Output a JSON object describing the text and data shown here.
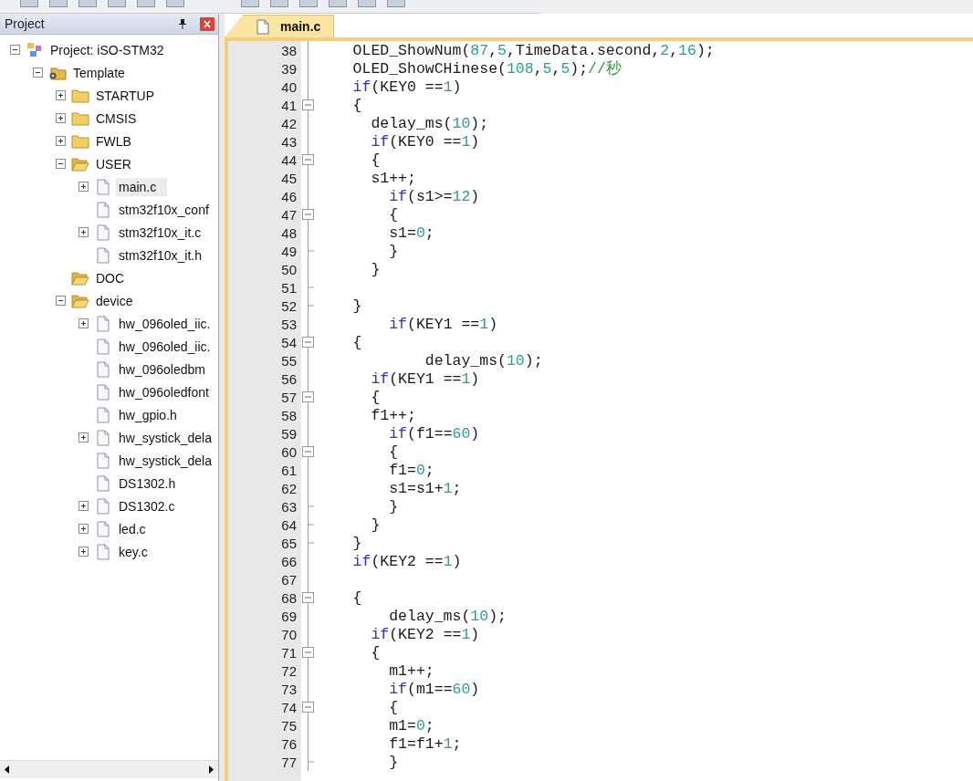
{
  "project_panel": {
    "title": "Project",
    "items": [
      {
        "label": "Project: iSO-STM32",
        "kind": "project",
        "expanded": true,
        "selected": false,
        "children": [
          {
            "label": "Template",
            "kind": "target",
            "expanded": true,
            "selected": false,
            "children": [
              {
                "label": "STARTUP",
                "kind": "folder",
                "expanded": false,
                "selected": false
              },
              {
                "label": "CMSIS",
                "kind": "folder",
                "expanded": false,
                "selected": false
              },
              {
                "label": "FWLB",
                "kind": "folder",
                "expanded": false,
                "selected": false
              },
              {
                "label": "USER",
                "kind": "open-folder",
                "expanded": true,
                "selected": false,
                "children": [
                  {
                    "label": "main.c",
                    "kind": "file",
                    "expanded": false,
                    "selected": true
                  },
                  {
                    "label": "stm32f10x_conf",
                    "kind": "file",
                    "selected": false
                  },
                  {
                    "label": "stm32f10x_it.c",
                    "kind": "file",
                    "expanded": false,
                    "selected": false
                  },
                  {
                    "label": "stm32f10x_it.h",
                    "kind": "file",
                    "selected": false
                  }
                ]
              },
              {
                "label": "DOC",
                "kind": "open-folder",
                "selected": false
              },
              {
                "label": "device",
                "kind": "open-folder",
                "expanded": true,
                "selected": false,
                "children": [
                  {
                    "label": "hw_096oled_iic.",
                    "kind": "file",
                    "expanded": false,
                    "selected": false
                  },
                  {
                    "label": "hw_096oled_iic.",
                    "kind": "file",
                    "selected": false
                  },
                  {
                    "label": "hw_096oledbm",
                    "kind": "file",
                    "selected": false
                  },
                  {
                    "label": "hw_096oledfont",
                    "kind": "file",
                    "selected": false
                  },
                  {
                    "label": "hw_gpio.h",
                    "kind": "file",
                    "selected": false
                  },
                  {
                    "label": "hw_systick_dela",
                    "kind": "file",
                    "expanded": false,
                    "selected": false
                  },
                  {
                    "label": "hw_systick_dela",
                    "kind": "file",
                    "selected": false
                  },
                  {
                    "label": "DS1302.h",
                    "kind": "file",
                    "selected": false
                  },
                  {
                    "label": "DS1302.c",
                    "kind": "file",
                    "expanded": false,
                    "selected": false
                  },
                  {
                    "label": "led.c",
                    "kind": "file",
                    "expanded": false,
                    "selected": false
                  },
                  {
                    "label": "key.c",
                    "kind": "file",
                    "expanded": false,
                    "selected": false
                  }
                ]
              }
            ]
          }
        ]
      }
    ]
  },
  "editor": {
    "tabs": [
      {
        "label": "main.c",
        "selected": true
      }
    ],
    "lines": [
      {
        "number": "38",
        "kind": "line",
        "tokens": [
          {
            "kind": "plain",
            "text": "    OLED_ShowNum("
          },
          {
            "kind": "number",
            "text": "87"
          },
          {
            "kind": "plain",
            "text": ","
          },
          {
            "kind": "number",
            "text": "5"
          },
          {
            "kind": "plain",
            "text": ",TimeData.second,"
          },
          {
            "kind": "number",
            "text": "2"
          },
          {
            "kind": "plain",
            "text": ","
          },
          {
            "kind": "number",
            "text": "16"
          },
          {
            "kind": "plain",
            "text": ");"
          }
        ]
      },
      {
        "number": "39",
        "kind": "line",
        "tokens": [
          {
            "kind": "plain",
            "text": "    OLED_ShowCHinese("
          },
          {
            "kind": "number",
            "text": "108"
          },
          {
            "kind": "plain",
            "text": ","
          },
          {
            "kind": "number",
            "text": "5"
          },
          {
            "kind": "plain",
            "text": ","
          },
          {
            "kind": "number",
            "text": "5"
          },
          {
            "kind": "plain",
            "text": ");"
          },
          {
            "kind": "comment",
            "text": "//秒"
          }
        ]
      },
      {
        "number": "40",
        "kind": "line",
        "tokens": [
          {
            "kind": "keyword",
            "text": "    if"
          },
          {
            "kind": "plain",
            "text": "(KEY0 =="
          },
          {
            "kind": "number",
            "text": "1"
          },
          {
            "kind": "plain",
            "text": ")"
          }
        ]
      },
      {
        "number": "41",
        "kind": "start",
        "tokens": [
          {
            "kind": "plain",
            "text": "    {"
          }
        ]
      },
      {
        "number": "42",
        "kind": "line",
        "tokens": [
          {
            "kind": "plain",
            "text": "      delay_ms("
          },
          {
            "kind": "number",
            "text": "10"
          },
          {
            "kind": "plain",
            "text": ");"
          }
        ]
      },
      {
        "number": "43",
        "kind": "line",
        "tokens": [
          {
            "kind": "keyword",
            "text": "      if"
          },
          {
            "kind": "plain",
            "text": "(KEY0 =="
          },
          {
            "kind": "number",
            "text": "1"
          },
          {
            "kind": "plain",
            "text": ")"
          }
        ]
      },
      {
        "number": "44",
        "kind": "start",
        "tokens": [
          {
            "kind": "plain",
            "text": "      {"
          }
        ]
      },
      {
        "number": "45",
        "kind": "line",
        "tokens": [
          {
            "kind": "plain",
            "text": "      s1++;"
          }
        ]
      },
      {
        "number": "46",
        "kind": "line",
        "tokens": [
          {
            "kind": "keyword",
            "text": "        if"
          },
          {
            "kind": "plain",
            "text": "(s1>="
          },
          {
            "kind": "number",
            "text": "12"
          },
          {
            "kind": "plain",
            "text": ")"
          }
        ]
      },
      {
        "number": "47",
        "kind": "start",
        "tokens": [
          {
            "kind": "plain",
            "text": "        {"
          }
        ]
      },
      {
        "number": "48",
        "kind": "line",
        "tokens": [
          {
            "kind": "plain",
            "text": "        s1="
          },
          {
            "kind": "number",
            "text": "0"
          },
          {
            "kind": "plain",
            "text": ";"
          }
        ]
      },
      {
        "number": "49",
        "kind": "end",
        "tokens": [
          {
            "kind": "plain",
            "text": "        }"
          }
        ]
      },
      {
        "number": "50",
        "kind": "line",
        "tokens": [
          {
            "kind": "plain",
            "text": "      }"
          }
        ]
      },
      {
        "number": "51",
        "kind": "end"
      },
      {
        "number": "52",
        "kind": "end",
        "tokens": [
          {
            "kind": "plain",
            "text": "    }"
          }
        ]
      },
      {
        "number": "53",
        "kind": "line",
        "tokens": [
          {
            "kind": "keyword",
            "text": "        if"
          },
          {
            "kind": "plain",
            "text": "(KEY1 =="
          },
          {
            "kind": "number",
            "text": "1"
          },
          {
            "kind": "plain",
            "text": ")"
          }
        ]
      },
      {
        "number": "54",
        "kind": "start",
        "tokens": [
          {
            "kind": "plain",
            "text": "    {"
          }
        ]
      },
      {
        "number": "55",
        "kind": "line",
        "tokens": [
          {
            "kind": "plain",
            "text": "            delay_ms("
          },
          {
            "kind": "number",
            "text": "10"
          },
          {
            "kind": "plain",
            "text": ");"
          }
        ]
      },
      {
        "number": "56",
        "kind": "line",
        "tokens": [
          {
            "kind": "keyword",
            "text": "      if"
          },
          {
            "kind": "plain",
            "text": "(KEY1 =="
          },
          {
            "kind": "number",
            "text": "1"
          },
          {
            "kind": "plain",
            "text": ")"
          }
        ]
      },
      {
        "number": "57",
        "kind": "start",
        "tokens": [
          {
            "kind": "plain",
            "text": "      {"
          }
        ]
      },
      {
        "number": "58",
        "kind": "line",
        "tokens": [
          {
            "kind": "plain",
            "text": "      f1++;"
          }
        ]
      },
      {
        "number": "59",
        "kind": "line",
        "tokens": [
          {
            "kind": "keyword",
            "text": "        if"
          },
          {
            "kind": "plain",
            "text": "(f1=="
          },
          {
            "kind": "number",
            "text": "60"
          },
          {
            "kind": "plain",
            "text": ")"
          }
        ]
      },
      {
        "number": "60",
        "kind": "start",
        "tokens": [
          {
            "kind": "plain",
            "text": "        {"
          }
        ]
      },
      {
        "number": "61",
        "kind": "line",
        "tokens": [
          {
            "kind": "plain",
            "text": "        f1="
          },
          {
            "kind": "number",
            "text": "0"
          },
          {
            "kind": "plain",
            "text": ";"
          }
        ]
      },
      {
        "number": "62",
        "kind": "line",
        "tokens": [
          {
            "kind": "plain",
            "text": "        s1=s1+"
          },
          {
            "kind": "number",
            "text": "1"
          },
          {
            "kind": "plain",
            "text": ";"
          }
        ]
      },
      {
        "number": "63",
        "kind": "end",
        "tokens": [
          {
            "kind": "plain",
            "text": "        }"
          }
        ]
      },
      {
        "number": "64",
        "kind": "end",
        "tokens": [
          {
            "kind": "plain",
            "text": "      }"
          }
        ]
      },
      {
        "number": "65",
        "kind": "end",
        "tokens": [
          {
            "kind": "plain",
            "text": "    }"
          }
        ]
      },
      {
        "number": "66",
        "kind": "line",
        "tokens": [
          {
            "kind": "keyword",
            "text": "    if"
          },
          {
            "kind": "plain",
            "text": "(KEY2 =="
          },
          {
            "kind": "number",
            "text": "1"
          },
          {
            "kind": "plain",
            "text": ")"
          }
        ]
      },
      {
        "number": "67",
        "kind": "line"
      },
      {
        "number": "68",
        "kind": "start",
        "tokens": [
          {
            "kind": "plain",
            "text": "    {"
          }
        ]
      },
      {
        "number": "69",
        "kind": "line",
        "tokens": [
          {
            "kind": "plain",
            "text": "        delay_ms("
          },
          {
            "kind": "number",
            "text": "10"
          },
          {
            "kind": "plain",
            "text": ");"
          }
        ]
      },
      {
        "number": "70",
        "kind": "line",
        "tokens": [
          {
            "kind": "keyword",
            "text": "      if"
          },
          {
            "kind": "plain",
            "text": "(KEY2 =="
          },
          {
            "kind": "number",
            "text": "1"
          },
          {
            "kind": "plain",
            "text": ")"
          }
        ]
      },
      {
        "number": "71",
        "kind": "start",
        "tokens": [
          {
            "kind": "plain",
            "text": "      {"
          }
        ]
      },
      {
        "number": "72",
        "kind": "line",
        "tokens": [
          {
            "kind": "plain",
            "text": "        m1++;"
          }
        ]
      },
      {
        "number": "73",
        "kind": "line",
        "tokens": [
          {
            "kind": "keyword",
            "text": "        if"
          },
          {
            "kind": "plain",
            "text": "(m1=="
          },
          {
            "kind": "number",
            "text": "60"
          },
          {
            "kind": "plain",
            "text": ")"
          }
        ]
      },
      {
        "number": "74",
        "kind": "start",
        "tokens": [
          {
            "kind": "plain",
            "text": "        {"
          }
        ]
      },
      {
        "number": "75",
        "kind": "line",
        "tokens": [
          {
            "kind": "plain",
            "text": "        m1="
          },
          {
            "kind": "number",
            "text": "0"
          },
          {
            "kind": "plain",
            "text": ";"
          }
        ]
      },
      {
        "number": "76",
        "kind": "line",
        "tokens": [
          {
            "kind": "plain",
            "text": "        f1=f1+"
          },
          {
            "kind": "number",
            "text": "1"
          },
          {
            "kind": "plain",
            "text": ";"
          }
        ]
      },
      {
        "number": "77",
        "kind": "end",
        "tokens": [
          {
            "kind": "plain",
            "text": "        }"
          }
        ]
      }
    ]
  }
}
